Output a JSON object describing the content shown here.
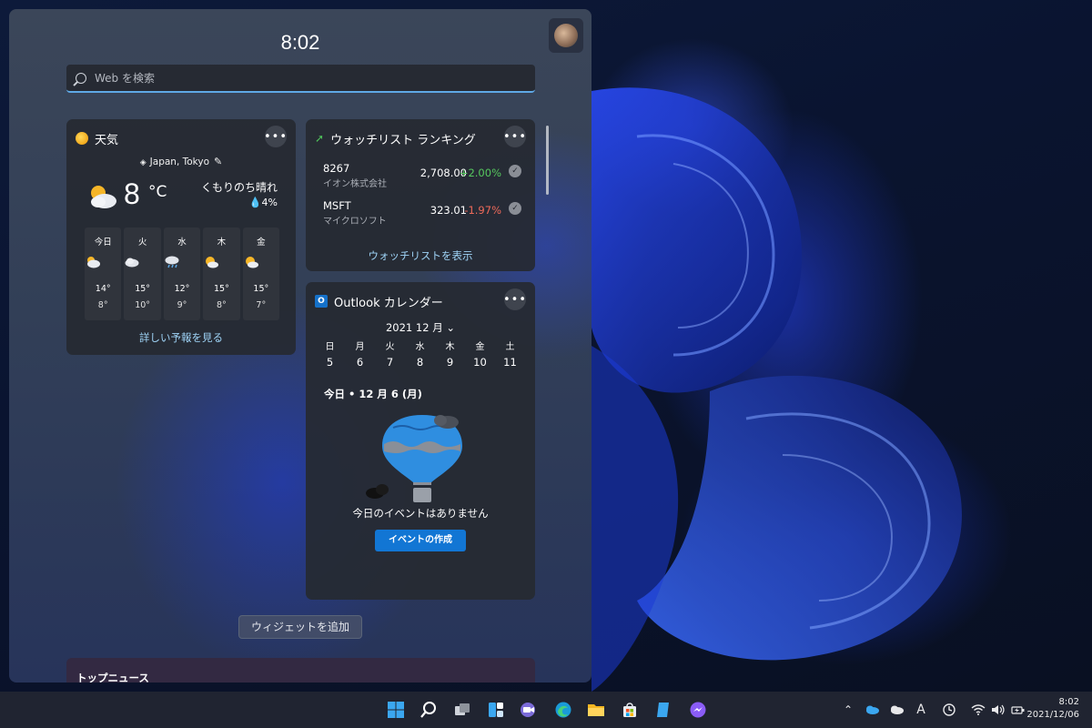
{
  "panel": {
    "time": "8:02",
    "search_placeholder": "Web を検索"
  },
  "weather": {
    "title": "天気",
    "location": "Japan, Tokyo",
    "temperature": "8",
    "unit": "°C",
    "condition": "くもりのち晴れ",
    "precip": "4%",
    "forecast": [
      {
        "day": "今日",
        "hi": "14°",
        "lo": "8°",
        "icon": "partly-cloudy-icon"
      },
      {
        "day": "火",
        "hi": "15°",
        "lo": "10°",
        "icon": "cloudy-icon"
      },
      {
        "day": "水",
        "hi": "12°",
        "lo": "9°",
        "icon": "rain-icon"
      },
      {
        "day": "木",
        "hi": "15°",
        "lo": "8°",
        "icon": "partly-sunny-icon"
      },
      {
        "day": "金",
        "hi": "15°",
        "lo": "7°",
        "icon": "partly-sunny-icon"
      }
    ],
    "link": "詳しい予報を見る"
  },
  "watchlist": {
    "title": "ウォッチリスト ランキング",
    "stocks": [
      {
        "symbol": "8267",
        "name": "イオン株式会社",
        "price": "2,708.00",
        "change": "+2.00%",
        "trend": "up"
      },
      {
        "symbol": "MSFT",
        "name": "マイクロソフト",
        "price": "323.01",
        "change": "-1.97%",
        "trend": "down"
      }
    ],
    "link": "ウォッチリストを表示"
  },
  "calendar": {
    "title": "Outlook カレンダー",
    "month": "2021 12 月",
    "weekdays": [
      "日",
      "月",
      "火",
      "水",
      "木",
      "金",
      "土"
    ],
    "days": [
      "5",
      "6",
      "7",
      "8",
      "9",
      "10",
      "11"
    ],
    "selected_day": "6",
    "today_label": "今日 • 12 月 6 (月)",
    "no_events": "今日のイベントはありません",
    "create_button": "イベントの作成"
  },
  "add_widget_button": "ウィジェットを追加",
  "news": {
    "title": "トップニュース"
  },
  "taskbar": {
    "clock_time": "8:02",
    "clock_date": "2021/12/06",
    "ime": "A",
    "icons": [
      "start-icon",
      "search-icon",
      "task-view-icon",
      "widgets-icon",
      "chat-icon",
      "edge-icon",
      "file-explorer-icon",
      "store-icon",
      "notes-icon",
      "messenger-icon"
    ]
  },
  "colors": {
    "accent": "#2b78c6",
    "link": "#9fd4f7",
    "positive": "#56c85e",
    "negative": "#ef6a5a"
  }
}
